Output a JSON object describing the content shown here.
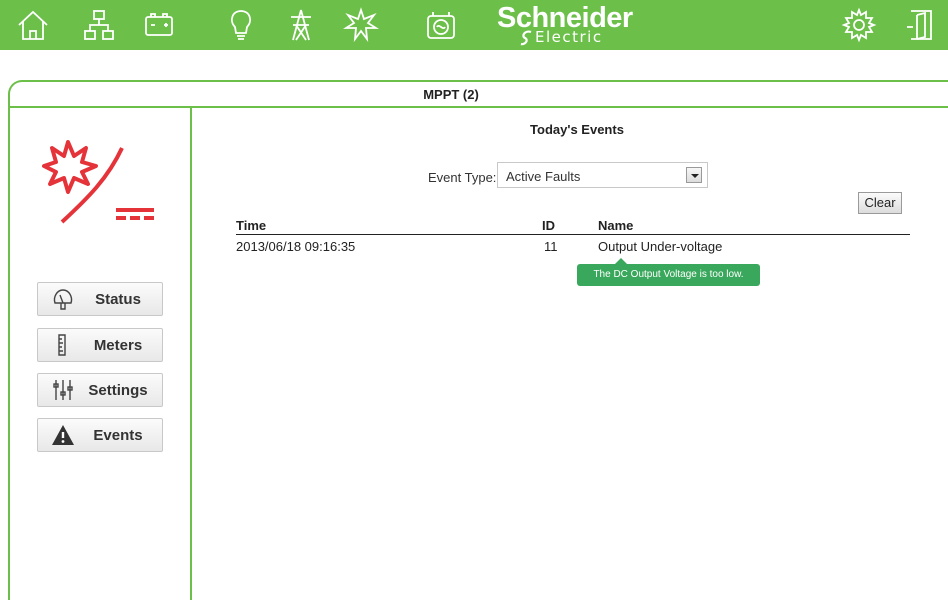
{
  "topbar": {
    "icons": [
      "home-icon",
      "network-icon",
      "battery-icon",
      "lightbulb-icon",
      "tower-icon",
      "solar-icon",
      "generator-icon"
    ],
    "brand": {
      "name": "Schneider",
      "sub": "Electric"
    },
    "right_icons": [
      "settings-gear-icon",
      "exit-door-icon"
    ],
    "accent_color": "#6cc04a"
  },
  "panel": {
    "title": "MPPT (2)"
  },
  "sidebar": {
    "device_icon": "mppt-solar-charger-icon",
    "nav": [
      {
        "label": "Status",
        "icon": "status-gauge-icon"
      },
      {
        "label": "Meters",
        "icon": "meters-ruler-icon"
      },
      {
        "label": "Settings",
        "icon": "settings-sliders-icon"
      },
      {
        "label": "Events",
        "icon": "warning-triangle-icon"
      }
    ]
  },
  "events": {
    "title": "Today's Events",
    "event_type_label": "Event Type:",
    "event_type_value": "Active Faults",
    "clear_label": "Clear",
    "columns": {
      "time": "Time",
      "id": "ID",
      "name": "Name"
    },
    "rows": [
      {
        "time": "2013/06/18 09:16:35",
        "id": "11",
        "name": "Output Under-voltage"
      }
    ],
    "tooltip": "The DC Output Voltage is too low.",
    "tooltip_color": "#3aa85c"
  }
}
